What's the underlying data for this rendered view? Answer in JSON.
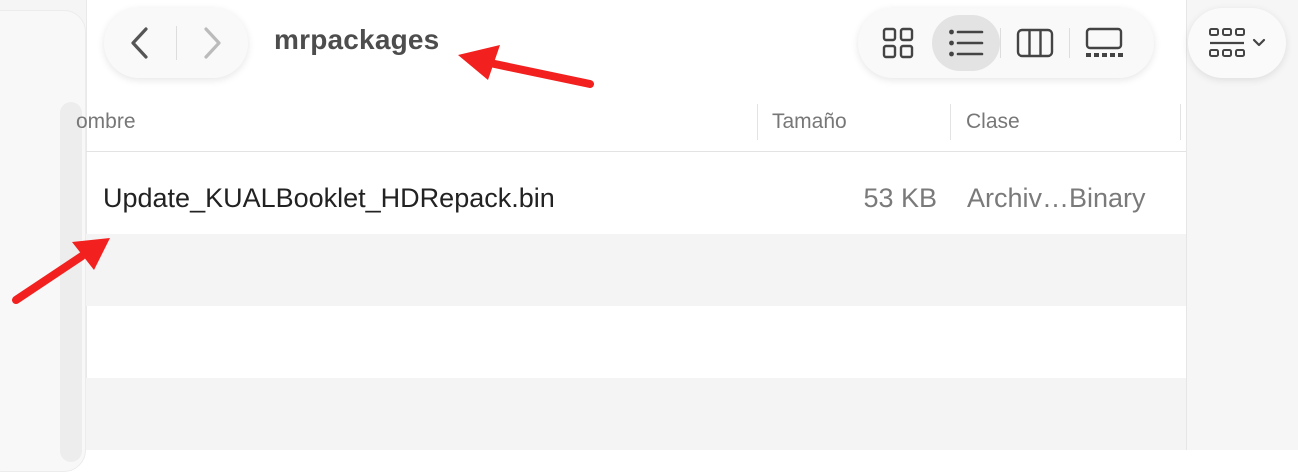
{
  "window": {
    "title": "mrpackages"
  },
  "toolbar": {
    "back_icon": "chevron-left-icon",
    "forward_icon": "chevron-right-icon",
    "view_buttons": [
      {
        "name": "icon-view",
        "icon": "grid-icon",
        "active": false
      },
      {
        "name": "list-view",
        "icon": "list-icon",
        "active": true
      },
      {
        "name": "column-view",
        "icon": "columns-icon",
        "active": false
      },
      {
        "name": "gallery-view",
        "icon": "gallery-icon",
        "active": false
      }
    ],
    "group_icon": "group-by-icon"
  },
  "table": {
    "columns": {
      "name": "ombre",
      "size": "Tamaño",
      "kind": "Clase"
    },
    "rows": [
      {
        "name": "Update_KUALBooklet_HDRepack.bin",
        "size": "53 KB",
        "kind": "Archiv…Binary"
      }
    ]
  },
  "colors": {
    "annotation_arrow": "#f2201e",
    "active_view_bg": "#e3e3e3",
    "alt_row_bg": "#f4f4f4"
  }
}
